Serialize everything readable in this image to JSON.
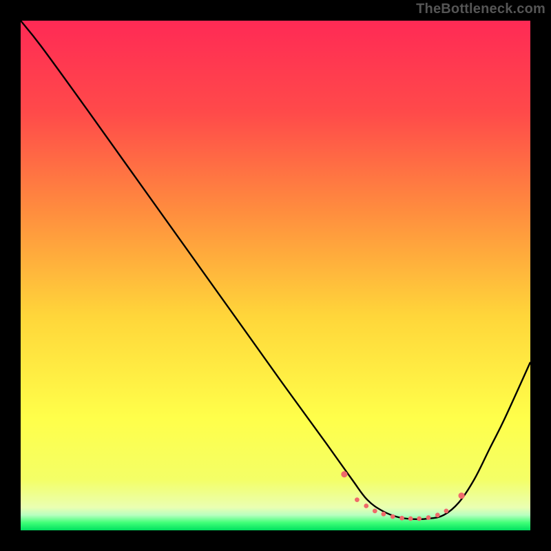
{
  "watermark": "TheBottleneck.com",
  "chart_data": {
    "type": "line",
    "title": "",
    "xlabel": "",
    "ylabel": "",
    "xlim": [
      0,
      100
    ],
    "ylim": [
      0,
      100
    ],
    "gradient_stops": [
      {
        "offset": 0.0,
        "color": "#ff2a55"
      },
      {
        "offset": 0.18,
        "color": "#ff4a4a"
      },
      {
        "offset": 0.38,
        "color": "#ff8f3e"
      },
      {
        "offset": 0.58,
        "color": "#ffd63a"
      },
      {
        "offset": 0.78,
        "color": "#ffff4a"
      },
      {
        "offset": 0.9,
        "color": "#f4ff66"
      },
      {
        "offset": 0.955,
        "color": "#eaffb2"
      },
      {
        "offset": 0.97,
        "color": "#b8ffc0"
      },
      {
        "offset": 0.985,
        "color": "#3fff77"
      },
      {
        "offset": 1.0,
        "color": "#00e060"
      }
    ],
    "series": [
      {
        "name": "curve",
        "x": [
          0,
          4,
          12,
          22,
          32,
          42,
          52,
          60,
          65,
          68,
          71,
          74,
          77,
          80,
          83,
          86,
          89,
          92,
          95,
          100
        ],
        "y": [
          100,
          95,
          84,
          70,
          56,
          42,
          28,
          17,
          10,
          6,
          3.8,
          2.6,
          2.2,
          2.3,
          3.0,
          5.5,
          10,
          16,
          22,
          33
        ]
      }
    ],
    "markers": {
      "name": "highlight-points",
      "color": "#ef6a6a",
      "radius_small": 3.4,
      "radius_large": 4.6,
      "points": [
        {
          "x": 63.5,
          "y": 11.0,
          "r": "large"
        },
        {
          "x": 66.0,
          "y": 6.0,
          "r": "small"
        },
        {
          "x": 67.8,
          "y": 4.8,
          "r": "small"
        },
        {
          "x": 69.5,
          "y": 3.8,
          "r": "small"
        },
        {
          "x": 71.2,
          "y": 3.2,
          "r": "small"
        },
        {
          "x": 73.0,
          "y": 2.7,
          "r": "small"
        },
        {
          "x": 74.8,
          "y": 2.4,
          "r": "small"
        },
        {
          "x": 76.5,
          "y": 2.3,
          "r": "small"
        },
        {
          "x": 78.2,
          "y": 2.3,
          "r": "small"
        },
        {
          "x": 80.0,
          "y": 2.5,
          "r": "small"
        },
        {
          "x": 81.8,
          "y": 3.0,
          "r": "small"
        },
        {
          "x": 83.5,
          "y": 3.8,
          "r": "small"
        },
        {
          "x": 86.5,
          "y": 6.8,
          "r": "large"
        }
      ]
    }
  }
}
